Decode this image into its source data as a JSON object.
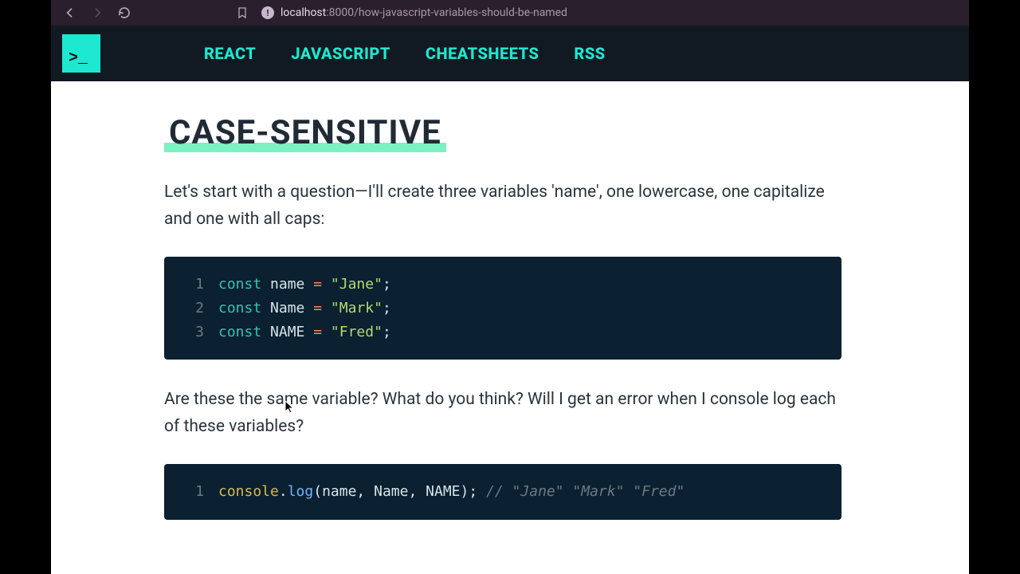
{
  "browser": {
    "url_host": "localhost",
    "url_port": ":8000",
    "url_path": "/how-javascript-variables-should-be-named"
  },
  "nav": {
    "logo_text": ">_",
    "links": [
      "REACT",
      "JAVASCRIPT",
      "CHEATSHEETS",
      "RSS"
    ]
  },
  "article": {
    "heading": "CASE-SENSITIVE",
    "para1": "Let's start with a question—I'll create three variables 'name', one lowercase, one capitalize and one with all caps:",
    "para2": "Are these the same variable? What do you think? Will I get an error when I console log each of these variables?",
    "code1": {
      "lines": [
        {
          "n": "1",
          "kw": "const",
          "id": "name",
          "op": "=",
          "str": "\"Jane\"",
          "end": ";"
        },
        {
          "n": "2",
          "kw": "const",
          "id": "Name",
          "op": "=",
          "str": "\"Mark\"",
          "end": ";"
        },
        {
          "n": "3",
          "kw": "const",
          "id": "NAME",
          "op": "=",
          "str": "\"Fred\"",
          "end": ";"
        }
      ]
    },
    "code2": {
      "line": {
        "n": "1",
        "obj": "console",
        "dot": ".",
        "fn": "log",
        "open": "(",
        "args": [
          "name",
          "Name",
          "NAME"
        ],
        "close": ")",
        "end": ";",
        "comment": "// \"Jane\" \"Mark\" \"Fred\""
      }
    }
  }
}
